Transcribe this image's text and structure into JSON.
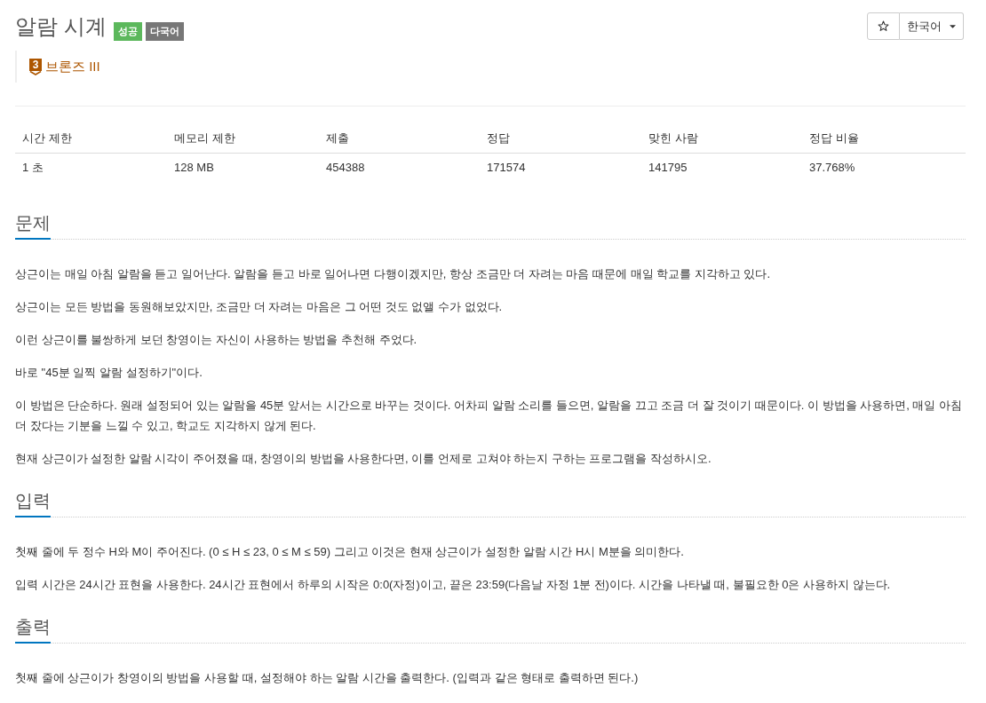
{
  "title": "알람 시계",
  "labels": [
    {
      "text": "성공",
      "color": "#5cb85c"
    },
    {
      "text": "다국어",
      "color": "#777777"
    }
  ],
  "toolbar": {
    "language": "한국어"
  },
  "tier": {
    "number": "3",
    "name": "브론즈 III"
  },
  "info_table": {
    "columns": [
      "시간 제한",
      "메모리 제한",
      "제출",
      "정답",
      "맞힌 사람",
      "정답 비율"
    ],
    "rows": [
      [
        "1 초",
        "128 MB",
        "454388",
        "171574",
        "141795",
        "37.768%"
      ]
    ]
  },
  "sections": [
    {
      "heading": "문제",
      "paragraphs": [
        "상근이는 매일 아침 알람을 듣고 일어난다. 알람을 듣고 바로 일어나면 다행이겠지만, 항상 조금만 더 자려는 마음 때문에 매일 학교를 지각하고 있다.",
        "상근이는 모든 방법을 동원해보았지만, 조금만 더 자려는 마음은 그 어떤 것도 없앨 수가 없었다.",
        "이런 상근이를 불쌍하게 보던 창영이는 자신이 사용하는 방법을 추천해 주었다.",
        "바로 \"45분 일찍 알람 설정하기\"이다.",
        "이 방법은 단순하다. 원래 설정되어 있는 알람을 45분 앞서는 시간으로 바꾸는 것이다. 어차피 알람 소리를 들으면, 알람을 끄고 조금 더 잘 것이기 때문이다. 이 방법을 사용하면, 매일 아침 더 잤다는 기분을 느낄 수 있고, 학교도 지각하지 않게 된다.",
        "현재 상근이가 설정한 알람 시각이 주어졌을 때, 창영이의 방법을 사용한다면, 이를 언제로 고쳐야 하는지 구하는 프로그램을 작성하시오."
      ]
    },
    {
      "heading": "입력",
      "paragraphs": [
        "첫째 줄에 두 정수 H와 M이 주어진다. (0 ≤ H ≤ 23, 0 ≤ M ≤ 59) 그리고 이것은 현재 상근이가 설정한 알람 시간 H시 M분을 의미한다.",
        "입력 시간은 24시간 표현을 사용한다. 24시간 표현에서 하루의 시작은 0:0(자정)이고, 끝은 23:59(다음날 자정 1분 전)이다. 시간을 나타낼 때, 불필요한 0은 사용하지 않는다."
      ]
    },
    {
      "heading": "출력",
      "paragraphs": [
        "첫째 줄에 상근이가 창영이의 방법을 사용할 때, 설정해야 하는 알람 시간을 출력한다. (입력과 같은 형태로 출력하면 된다.)"
      ]
    }
  ]
}
